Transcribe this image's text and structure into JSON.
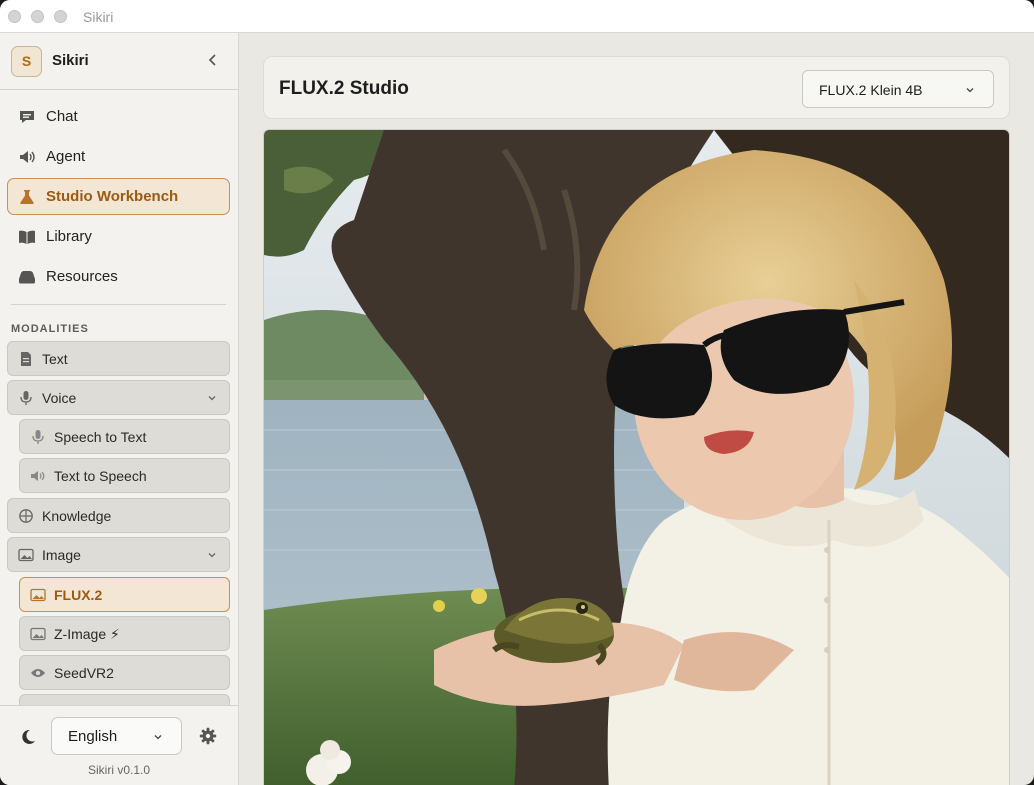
{
  "window": {
    "title": "Sikiri"
  },
  "sidebar": {
    "brand_initial": "S",
    "brand_name": "Sikiri",
    "nav": [
      {
        "label": "Chat",
        "icon": "chat-bubble-icon"
      },
      {
        "label": "Agent",
        "icon": "speaker-icon"
      },
      {
        "label": "Studio Workbench",
        "icon": "flask-icon",
        "active": true
      },
      {
        "label": "Library",
        "icon": "book-icon"
      },
      {
        "label": "Resources",
        "icon": "hard-drive-icon"
      }
    ],
    "modalities_label": "MODALITIES",
    "modalities": [
      {
        "label": "Text",
        "icon": "document-icon"
      },
      {
        "label": "Voice",
        "icon": "microphone-icon",
        "expanded": true
      },
      {
        "label": "Speech to Text",
        "icon": "microphone-icon"
      },
      {
        "label": "Text to Speech",
        "icon": "speaker-icon"
      },
      {
        "label": "Knowledge",
        "icon": "globe-icon"
      },
      {
        "label": "Image",
        "icon": "image-icon",
        "expanded": true
      },
      {
        "label": "FLUX.2",
        "icon": "image-icon",
        "active": true
      },
      {
        "label": "Z-Image ⚡",
        "icon": "image-icon"
      },
      {
        "label": "SeedVR2",
        "icon": "eye-icon"
      }
    ],
    "language": "English",
    "version": "Sikiri v0.1.0"
  },
  "main": {
    "title": "FLUX.2 Studio",
    "model": "FLUX.2 Klein 4B",
    "image_description": "Generated image: woman with sunglasses holding a frog by a lake"
  },
  "colors": {
    "accent": "#c79256",
    "accent_text": "#9c5a12",
    "sidebar_bg": "#f3f2ee",
    "main_bg": "#e9e8e3"
  }
}
